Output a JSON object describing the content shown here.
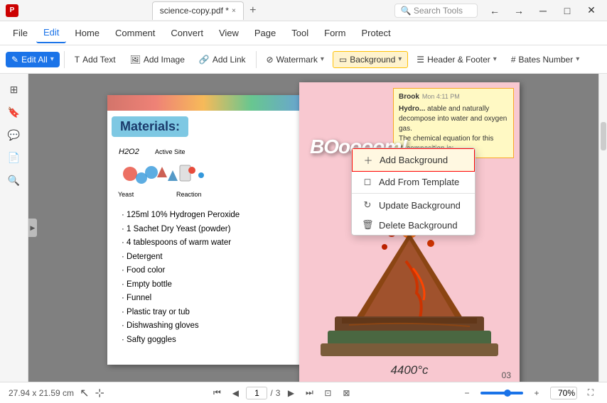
{
  "titlebar": {
    "app_icon": "P",
    "filename": "science-copy.pdf *",
    "tab_close": "×",
    "tab_add": "+",
    "search_placeholder": "Search Tools",
    "win_buttons": [
      "minimize",
      "maximize",
      "close"
    ]
  },
  "menubar": {
    "items": [
      {
        "id": "file",
        "label": "File"
      },
      {
        "id": "edit",
        "label": "Edit"
      },
      {
        "id": "home",
        "label": "Home"
      },
      {
        "id": "comment",
        "label": "Comment"
      },
      {
        "id": "convert",
        "label": "Convert"
      },
      {
        "id": "view",
        "label": "View"
      },
      {
        "id": "page",
        "label": "Page"
      },
      {
        "id": "tool",
        "label": "Tool"
      },
      {
        "id": "form",
        "label": "Form"
      },
      {
        "id": "protect",
        "label": "Protect"
      }
    ]
  },
  "toolbar": {
    "edit_all_label": "Edit All",
    "add_text_label": "Add Text",
    "add_image_label": "Add Image",
    "add_link_label": "Add Link",
    "watermark_label": "Watermark",
    "background_label": "Background",
    "header_footer_label": "Header & Footer",
    "bates_number_label": "Bates Number"
  },
  "dropdown": {
    "items": [
      {
        "id": "add-background",
        "label": "Add Background",
        "icon": "+",
        "highlighted": true
      },
      {
        "id": "add-from-template",
        "label": "Add From Template",
        "icon": "◻"
      },
      {
        "id": "update-background",
        "label": "Update Background",
        "icon": "↻"
      },
      {
        "id": "delete-background",
        "label": "Delete Background",
        "icon": "🗑"
      }
    ]
  },
  "pdf_left": {
    "top_image_alt": "banner image",
    "materials_header": "Materials:",
    "h2o2_label": "H2O2",
    "active_site_label": "Active Site",
    "yeast_label": "Yeast",
    "reaction_label": "Reaction",
    "materials_list": [
      "125ml 10% Hydrogen Peroxide",
      "1 Sachet Dry Yeast (powder)",
      "4 tablespoons of warm water",
      "Detergent",
      "Food color",
      "Empty bottle",
      "Funnel",
      "Plastic tray or tub",
      "Dishwashing gloves",
      "Safty goggles"
    ]
  },
  "pdf_right": {
    "note_name": "Brook",
    "note_time": "Mon 4:11 PM",
    "note_text_1": "Hydro... atable and naturally decompose into water and oxygen gas.",
    "note_text_2": "The chemical equation for this decomposition is:",
    "boom_text": "BOoooom!",
    "temp_text": "4400°c",
    "page_num": "03"
  },
  "statusbar": {
    "dimensions": "27.94 x 21.59 cm",
    "page_current": "1",
    "page_total": "3",
    "zoom_percent": "70%",
    "zoom_icon_minus": "−",
    "zoom_icon_plus": "+"
  },
  "sidebar_icons": [
    {
      "id": "thumbnails",
      "icon": "⊞"
    },
    {
      "id": "bookmarks",
      "icon": "🔖"
    },
    {
      "id": "comments",
      "icon": "💬"
    },
    {
      "id": "pages",
      "icon": "📄"
    },
    {
      "id": "search",
      "icon": "🔍"
    }
  ]
}
